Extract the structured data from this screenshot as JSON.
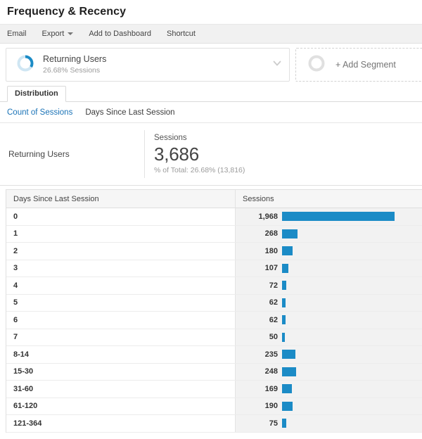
{
  "header": {
    "title": "Frequency & Recency"
  },
  "toolbar": {
    "items": [
      {
        "label": "Email",
        "icon": "none"
      },
      {
        "label": "Export",
        "icon": "chevron-down-icon"
      },
      {
        "label": "Add to Dashboard",
        "icon": "none"
      },
      {
        "label": "Shortcut",
        "icon": "none"
      }
    ]
  },
  "segments": {
    "applied": {
      "name": "Returning Users",
      "subtitle": "26.68% Sessions",
      "donut_track_color": "#cfe6f3",
      "donut_arc_color": "#1b8bc6",
      "donut_arc_percent": 26.68,
      "chevron_icon": "chevron-down-icon"
    },
    "add": {
      "label": "+ Add Segment",
      "donut_color": "#e0e0e0"
    }
  },
  "tabs": [
    {
      "label": "Distribution",
      "active": true
    }
  ],
  "sublinks": [
    {
      "label": "Count of Sessions",
      "active": false
    },
    {
      "label": "Days Since Last Session",
      "active": true
    }
  ],
  "summary": {
    "segment_label": "Returning Users",
    "metric_label": "Sessions",
    "metric_value": "3,686",
    "percent_of_total": "% of Total: 26.68% (13,816)"
  },
  "chart_data": {
    "type": "bar",
    "title": "Days Since Last Session",
    "xlabel": "Sessions",
    "ylabel": "Days Since Last Session",
    "orientation": "horizontal",
    "grid": false,
    "legend": false,
    "columns": [
      "Days Since Last Session",
      "Sessions"
    ],
    "categories": [
      "0",
      "1",
      "2",
      "3",
      "4",
      "5",
      "6",
      "7",
      "8-14",
      "15-30",
      "31-60",
      "61-120",
      "121-364"
    ],
    "values": [
      1968,
      268,
      180,
      107,
      72,
      62,
      62,
      50,
      235,
      248,
      169,
      190,
      75
    ],
    "value_labels": [
      "1,968",
      "268",
      "180",
      "107",
      "72",
      "62",
      "62",
      "50",
      "235",
      "248",
      "169",
      "190",
      "75"
    ],
    "xlim": [
      0,
      1968
    ],
    "bar_color": "#1b8bc6",
    "total": 3686
  }
}
